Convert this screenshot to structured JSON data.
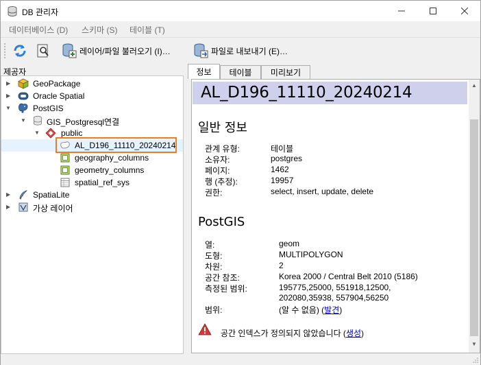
{
  "window": {
    "title": "DB 관리자"
  },
  "menu": {
    "items": [
      "데이터베이스 (D)",
      "스키마 (S)",
      "테이블 (T)"
    ]
  },
  "toolbar": {
    "import_label": "레이어/파일 불러오기 (I)…",
    "export_label": "파일로 내보내기 (E)…"
  },
  "providers": {
    "title": "제공자",
    "tree": [
      {
        "label": "GeoPackage"
      },
      {
        "label": "Oracle Spatial"
      },
      {
        "label": "PostGIS"
      },
      {
        "label": "GIS_Postgresql연결"
      },
      {
        "label": "public"
      },
      {
        "label": "AL_D196_11110_20240214"
      },
      {
        "label": "geography_columns"
      },
      {
        "label": "geometry_columns"
      },
      {
        "label": "spatial_ref_sys"
      },
      {
        "label": "SpatiaLite"
      },
      {
        "label": "가상 레이어"
      }
    ]
  },
  "tabs": [
    "정보",
    "테이블",
    "미리보기"
  ],
  "info": {
    "header": "AL_D196_11110_20240214",
    "general": {
      "title": "일반 정보",
      "rows": [
        {
          "label": "관계 유형:",
          "value": "테이블"
        },
        {
          "label": "소유자:",
          "value": "postgres"
        },
        {
          "label": "페이지:",
          "value": "1462"
        },
        {
          "label": "행 (추정):",
          "value": "19957"
        },
        {
          "label": "권한:",
          "value": "select, insert, update, delete"
        }
      ]
    },
    "postgis": {
      "title": "PostGIS",
      "rows": [
        {
          "label": "열:",
          "value": "geom"
        },
        {
          "label": "도형:",
          "value": "MULTIPOLYGON"
        },
        {
          "label": "차원:",
          "value": "2"
        },
        {
          "label": "공간 참조:",
          "value": "Korea 2000 / Central Belt 2010 (5186)"
        },
        {
          "label": "측정된 범위:",
          "value": "195775,25000, 551918,12500,"
        },
        {
          "label": "",
          "value": "202080,35938, 557904,56250"
        },
        {
          "label": "범위:",
          "value": "(알 수 없음) ("
        }
      ],
      "extent_link": "발견",
      "extent_close": ")"
    },
    "warning": {
      "text": "공간 인덱스가 정의되지 않았습니다 (",
      "link": "생성",
      "close": ")"
    }
  }
}
